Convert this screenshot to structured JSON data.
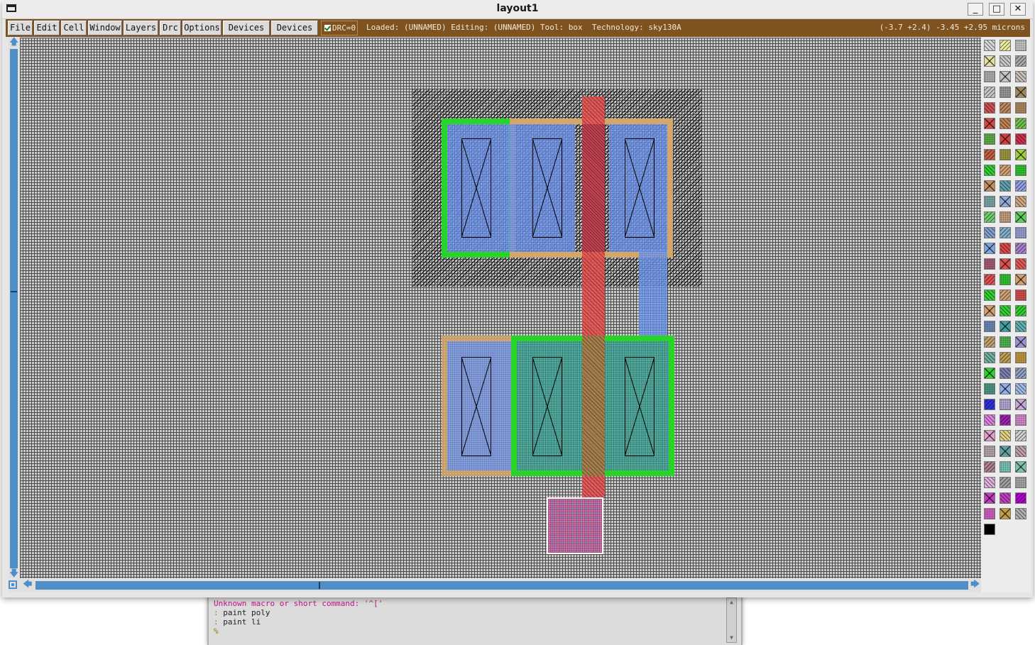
{
  "window": {
    "title": "layout1"
  },
  "window_controls": {
    "minimize": "_",
    "maximize": "□",
    "close": "✕"
  },
  "menu": [
    "File",
    "Edit",
    "Cell",
    "Window",
    "Layers",
    "Drc",
    "Options",
    "Devices 1",
    "Devices 2"
  ],
  "drc": {
    "label": "DRC=0",
    "checked": true
  },
  "status": "Loaded: (UNNAMED) Editing: (UNNAMED) Tool: box  Technology: sky130A",
  "coords": "(-3.7 +2.4) -3.45 +2.95 microns",
  "console": {
    "lines": [
      {
        "kind": "error",
        "text": "Unknown macro or short command: '^['"
      },
      {
        "kind": "cmd",
        "prompt": ":",
        "text": " paint poly"
      },
      {
        "kind": "cmd",
        "prompt": ":",
        "text": " paint li"
      },
      {
        "kind": "prompt",
        "prompt": "%",
        "text": ""
      }
    ]
  },
  "colors": {
    "toolbar": "#7f5320",
    "ndiff_green": "#28d428",
    "pdiff_tan": "#d4a66a",
    "poly_red": "#e25656",
    "local_interconnect_blue": "#7ca8ff",
    "scrollbar_blue": "#4f8fc8"
  },
  "palette": [
    [
      "#d8d8d8",
      "#ecec9a",
      "#d0d0d0"
    ],
    [
      "#e0e0a0",
      "#c8c8c8",
      "#a8a8a8"
    ],
    [
      "#b8b8b8",
      "#c4c4c4",
      "#c8c0b8"
    ],
    [
      "#c8c8c8",
      "#a0a0a0",
      "#a08860"
    ],
    [
      "#d05050",
      "#c08858",
      "#b89060"
    ],
    [
      "#d04848",
      "#c08050",
      "#70c050"
    ],
    [
      "#60b848",
      "#d04040",
      "#d03050"
    ],
    [
      "#c06040",
      "#a8a040",
      "#a0d040"
    ],
    [
      "#30d030",
      "#d0a070",
      "#30d030"
    ],
    [
      "#c09060",
      "#60a0b0",
      "#90a0e0"
    ],
    [
      "#80b0b0",
      "#90a8d8",
      "#d0a880"
    ],
    [
      "#70d070",
      "#d0a880",
      "#60d060"
    ],
    [
      "#80a0d0",
      "#80b0d0",
      "#a0a8e0"
    ],
    [
      "#80a8e0",
      "#e04848",
      "#a880d0"
    ],
    [
      "#b06080",
      "#e05050",
      "#e05858"
    ],
    [
      "#e05050",
      "#30d030",
      "#d0a070"
    ],
    [
      "#30d030",
      "#d0a070",
      "#e05050"
    ],
    [
      "#d0a070",
      "#30d030",
      "#30d030"
    ],
    [
      "#7090c0",
      "#40a0a0",
      "#60b0b0"
    ],
    [
      "#c0a070",
      "#50c050",
      "#a090d0"
    ],
    [
      "#70b0a0",
      "#c0a050",
      "#d0a040"
    ],
    [
      "#30d030",
      "#8080b0",
      "#90a0c0"
    ],
    [
      "#50a090",
      "#90b0e8",
      "#a0b8e8"
    ],
    [
      "#3030e0",
      "#c0b0e0",
      "#c8a8d8"
    ],
    [
      "#e080e0",
      "#a020b0",
      "#e090d8"
    ],
    [
      "#e0a0d0",
      "#e0d080",
      "#d0d0d0"
    ],
    [
      "#c0b0b0",
      "#60a0a0",
      "#c0a0b0"
    ],
    [
      "#b08090",
      "#80d0c0",
      "#80c0b0"
    ],
    [
      "#e0b0e0",
      "#a0a0a0",
      "#b0b0b0"
    ],
    [
      "#c040c0",
      "#c040c0",
      "#b000d0"
    ],
    [
      "#e060d0",
      "#c0a040",
      "#b0b0b0"
    ],
    [
      "#000000"
    ]
  ],
  "layout_shapes": [
    {
      "name": "ndiff-contact-1"
    },
    {
      "name": "ndiff-contact-2"
    },
    {
      "name": "ndiff-contact-3"
    },
    {
      "name": "pdiff-contact-1"
    },
    {
      "name": "pdiff-contact-2"
    },
    {
      "name": "pdiff-contact-3"
    }
  ]
}
